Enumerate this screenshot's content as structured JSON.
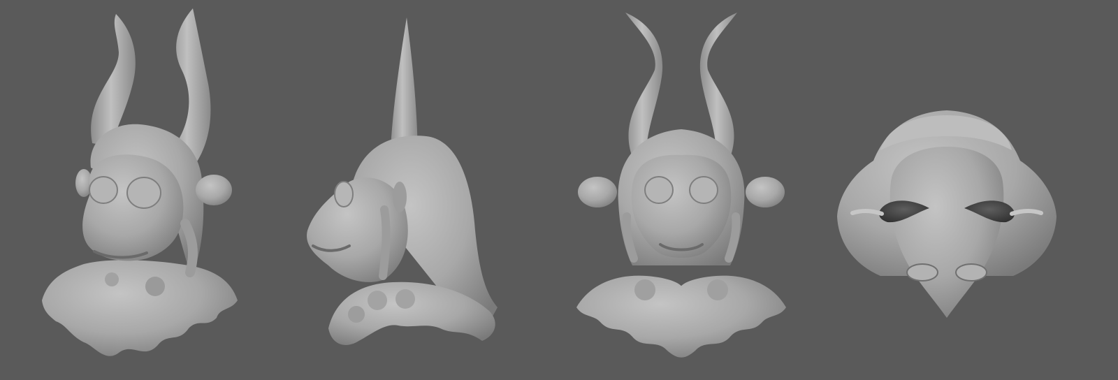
{
  "scene": {
    "background_color": "#5a5a5a",
    "model_color": "#a7a7a7",
    "shadow_color": "#6e6e6e",
    "highlight_color": "#c2c2c2",
    "views": [
      {
        "name": "three-quarter"
      },
      {
        "name": "side"
      },
      {
        "name": "front"
      },
      {
        "name": "top"
      }
    ]
  }
}
